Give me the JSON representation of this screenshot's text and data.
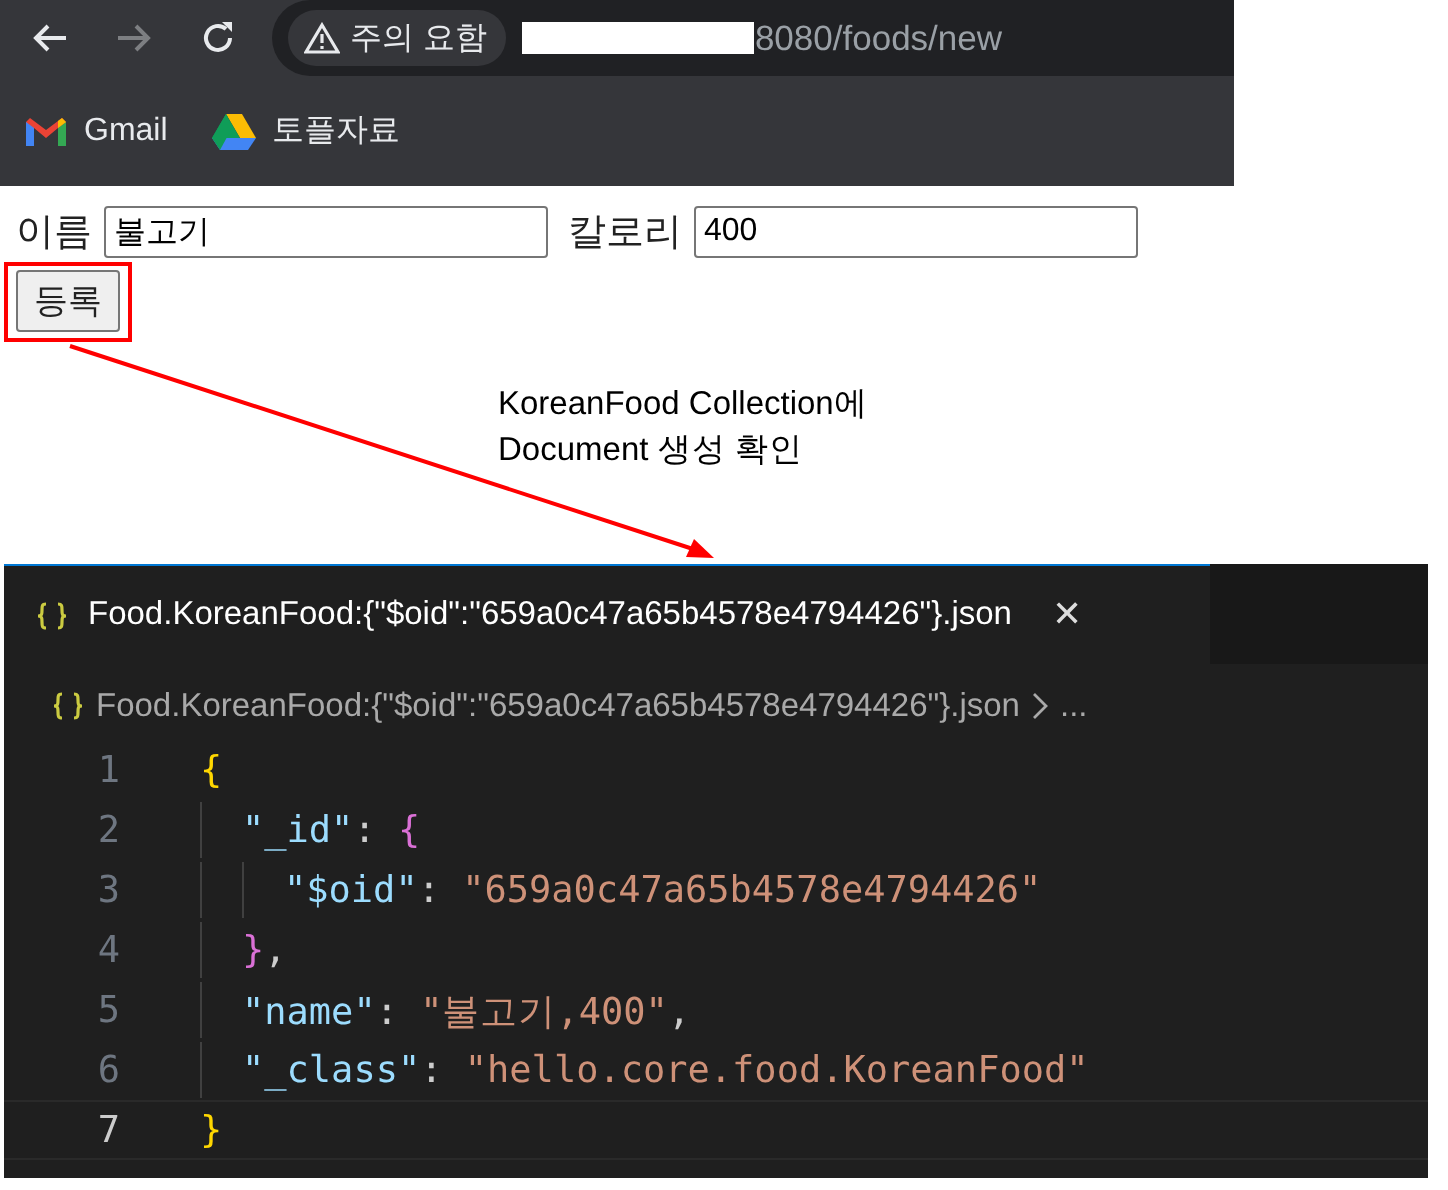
{
  "browser": {
    "security_chip": "주의 요함",
    "url": "8080/foods/new",
    "bookmarks": [
      {
        "kind": "gmail",
        "label": "Gmail"
      },
      {
        "kind": "drive",
        "label": "토플자료"
      }
    ]
  },
  "form": {
    "fields": [
      {
        "label": "이름",
        "value": "불고기"
      },
      {
        "label": "칼로리",
        "value": "400"
      }
    ],
    "submit": "등록"
  },
  "annotation": "KoreanFood Collection에\nDocument 생성 확인",
  "editor": {
    "tab": {
      "title": "Food.KoreanFood:{\"$oid\":\"659a0c47a65b4578e4794426\"}.json",
      "close": "✕"
    },
    "breadcrumb": {
      "path": "Food.KoreanFood:{\"$oid\":\"659a0c47a65b4578e4794426\"}.json",
      "more": "..."
    },
    "lines": [
      {
        "number": "1",
        "current": false,
        "tokens": [
          {
            "kind": "brace",
            "text": "{"
          }
        ],
        "children": [
          {
            "number": "2",
            "current": false,
            "tokens": [
              {
                "kind": "key",
                "text": "\"_id\""
              },
              {
                "kind": "punct",
                "text": ": "
              },
              {
                "kind": "brace2",
                "text": "{"
              }
            ],
            "children": [
              {
                "number": "3",
                "current": false,
                "tokens": [
                  {
                    "kind": "key",
                    "text": "\"$oid\""
                  },
                  {
                    "kind": "punct",
                    "text": ": "
                  },
                  {
                    "kind": "string",
                    "text": "\"659a0c47a65b4578e4794426\""
                  }
                ]
              }
            ]
          },
          {
            "number": "4",
            "current": false,
            "tokens": [
              {
                "kind": "brace2",
                "text": "}"
              },
              {
                "kind": "punct",
                "text": ","
              }
            ]
          },
          {
            "number": "5",
            "current": false,
            "tokens": [
              {
                "kind": "key",
                "text": "\"name\""
              },
              {
                "kind": "punct",
                "text": ": "
              },
              {
                "kind": "string",
                "text": "\"불고기,400\""
              },
              {
                "kind": "punct",
                "text": ","
              }
            ]
          },
          {
            "number": "6",
            "current": false,
            "tokens": [
              {
                "kind": "key",
                "text": "\"_class\""
              },
              {
                "kind": "punct",
                "text": ": "
              },
              {
                "kind": "string",
                "text": "\"hello.core.food.KoreanFood\""
              }
            ]
          }
        ]
      },
      {
        "number": "7",
        "current": true,
        "tokens": [
          {
            "kind": "brace",
            "text": "}"
          }
        ]
      }
    ]
  }
}
